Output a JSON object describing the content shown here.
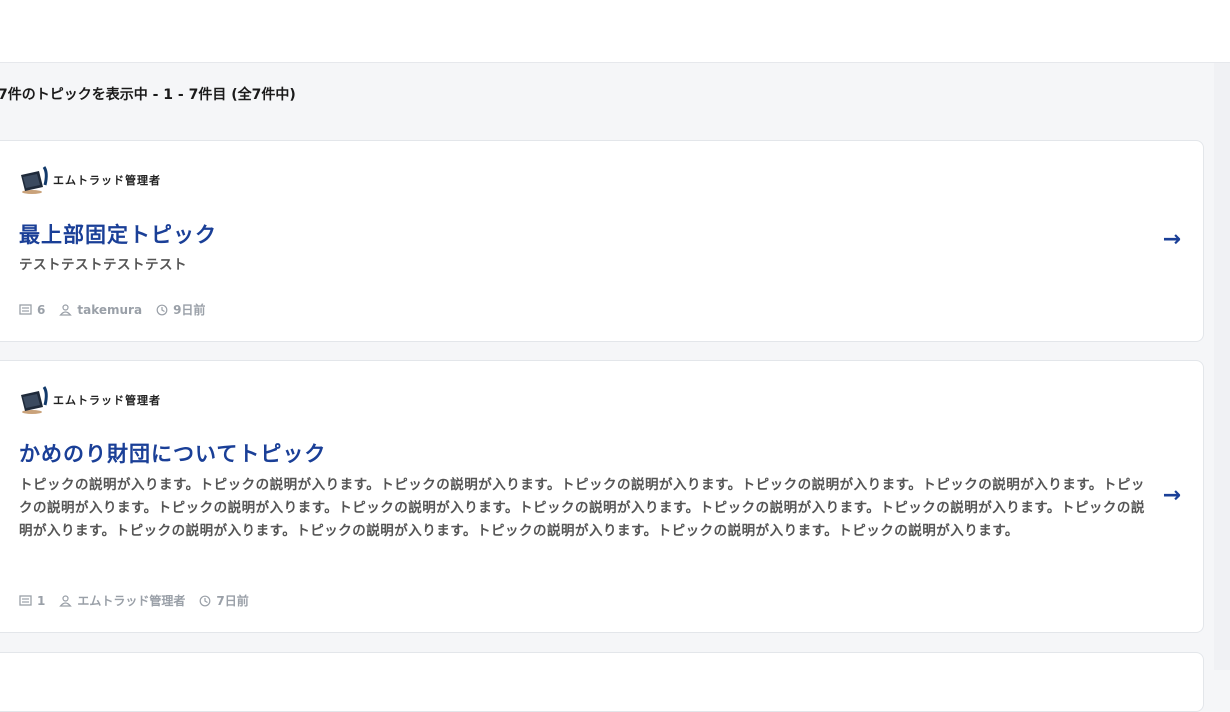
{
  "summary": "7件のトピックを表示中 - 1 - 7件目 (全7件中)",
  "colors": {
    "accent": "#1a3f97",
    "muted": "#9aa0a8",
    "background": "#f5f6f8"
  },
  "topics": [
    {
      "author": "エムトラッド管理者",
      "title": "最上部固定トピック",
      "description": "テストテストテストテスト",
      "replies": "6",
      "user": "takemura",
      "time": "9日前",
      "arrow": "→"
    },
    {
      "author": "エムトラッド管理者",
      "title": "かめのり財団についてトピック",
      "description": "トピックの説明が入ります。トピックの説明が入ります。トピックの説明が入ります。トピックの説明が入ります。トピックの説明が入ります。トピックの説明が入ります。トピックの説明が入ります。トピックの説明が入ります。トピックの説明が入ります。トピックの説明が入ります。トピックの説明が入ります。トピックの説明が入ります。トピックの説明が入ります。トピックの説明が入ります。トピックの説明が入ります。トピックの説明が入ります。トピックの説明が入ります。トピックの説明が入ります。",
      "replies": "1",
      "user": "エムトラッド管理者",
      "time": "7日前",
      "arrow": "→"
    }
  ]
}
